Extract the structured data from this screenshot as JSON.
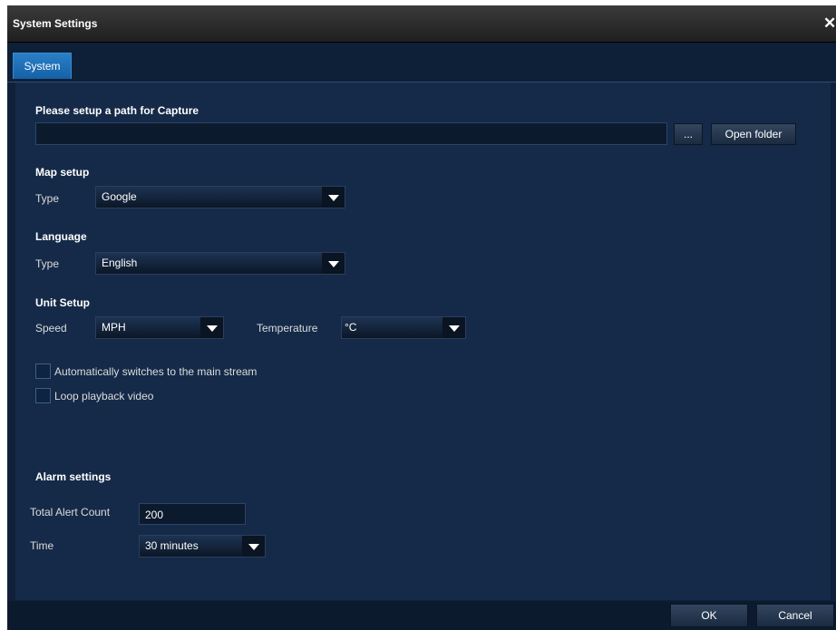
{
  "window": {
    "title": "System Settings",
    "close_glyph": "✕"
  },
  "tabs": [
    {
      "label": "System"
    }
  ],
  "capture": {
    "title": "Please setup a path for Capture",
    "path_value": "",
    "browse_label": "...",
    "open_folder_label": "Open folder"
  },
  "map": {
    "title": "Map setup",
    "type_label": "Type",
    "type_value": "Google"
  },
  "language": {
    "title": "Language",
    "type_label": "Type",
    "type_value": "English"
  },
  "unit": {
    "title": "Unit Setup",
    "speed_label": "Speed",
    "speed_value": "MPH",
    "temperature_label": "Temperature",
    "temperature_value": "°C"
  },
  "options": [
    {
      "label": "Automatically switches to the main stream",
      "checked": false
    },
    {
      "label": "Loop playback video",
      "checked": false
    }
  ],
  "alarm": {
    "title": "Alarm settings",
    "count_label": "Total Alert Count",
    "count_value": "200",
    "time_label": "Time",
    "time_value": "30 minutes"
  },
  "footer": {
    "ok_label": "OK",
    "cancel_label": "Cancel"
  },
  "icons": {
    "close": "close-icon",
    "dropdown": "chevron-down-icon"
  }
}
